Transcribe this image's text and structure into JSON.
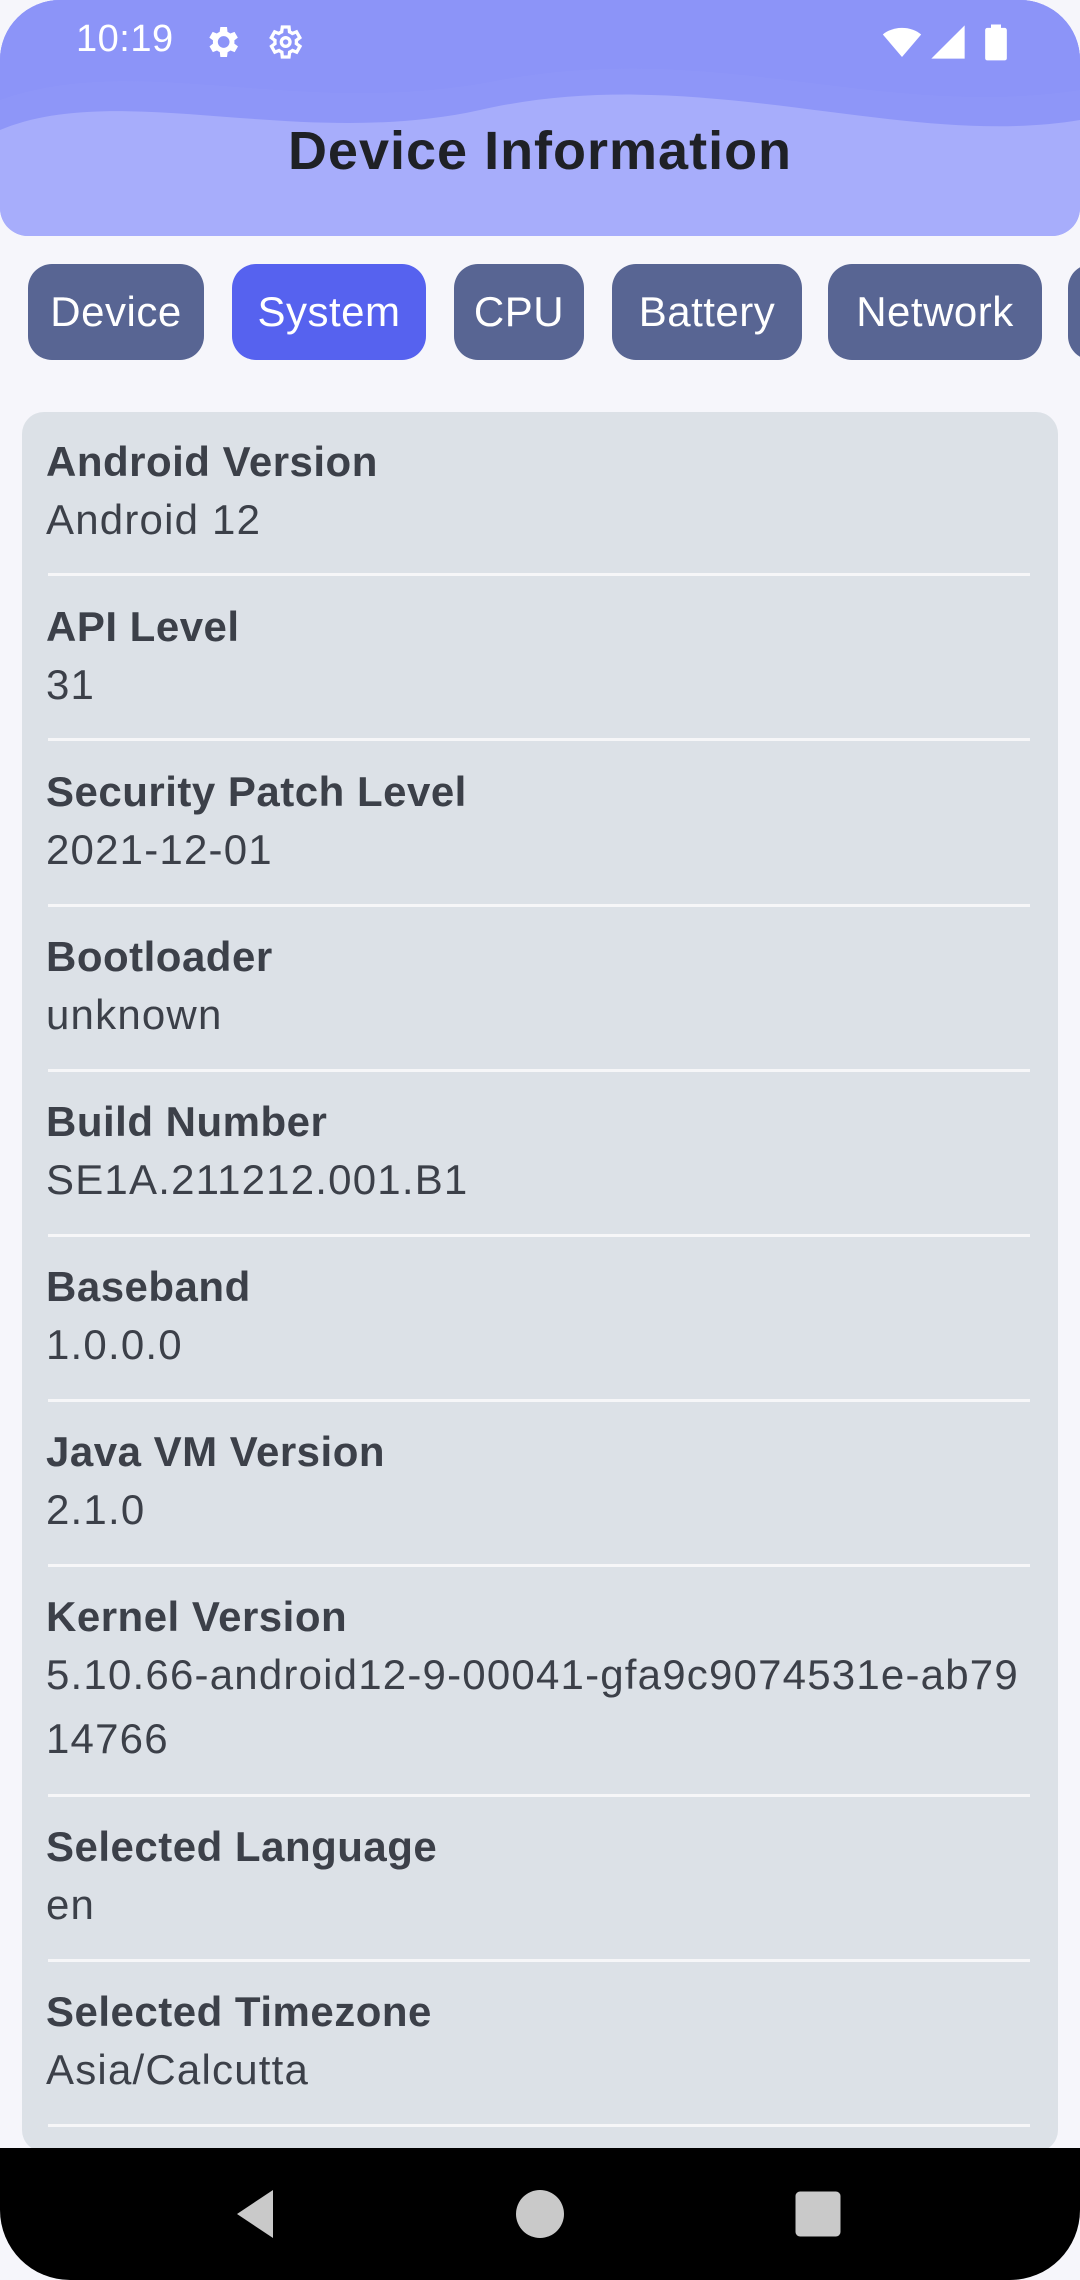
{
  "status_bar": {
    "time": "10:19",
    "left_icons": [
      "gear-icon",
      "settings-outline-icon"
    ],
    "right_icons": [
      "wifi-icon",
      "signal-icon",
      "battery-icon"
    ]
  },
  "header": {
    "title": "Device Information"
  },
  "tabs": [
    {
      "label": "Device",
      "active": false
    },
    {
      "label": "System",
      "active": true
    },
    {
      "label": "CPU",
      "active": false
    },
    {
      "label": "Battery",
      "active": false
    },
    {
      "label": "Network",
      "active": false
    }
  ],
  "system_info": [
    {
      "label": "Android Version",
      "value": "Android 12"
    },
    {
      "label": "API Level",
      "value": "31"
    },
    {
      "label": "Security Patch Level",
      "value": "2021-12-01"
    },
    {
      "label": "Bootloader",
      "value": "unknown"
    },
    {
      "label": "Build Number",
      "value": "SE1A.211212.001.B1"
    },
    {
      "label": "Baseband",
      "value": "1.0.0.0"
    },
    {
      "label": "Java VM Version",
      "value": "2.1.0"
    },
    {
      "label": "Kernel Version",
      "value": "5.10.66-android12-9-00041-gfa9c9074531e-ab7914766"
    },
    {
      "label": "Selected Language",
      "value": "en"
    },
    {
      "label": "Selected Timezone",
      "value": "Asia/Calcutta"
    }
  ],
  "nav_bar": {
    "buttons": [
      "back-icon",
      "home-icon",
      "recents-icon"
    ]
  },
  "colors": {
    "header_bg": "#a7adfb",
    "tab_bg": "#586593",
    "tab_active_bg": "#5662ef",
    "card_bg": "#dce1e7",
    "page_bg": "#f6f6fb"
  }
}
